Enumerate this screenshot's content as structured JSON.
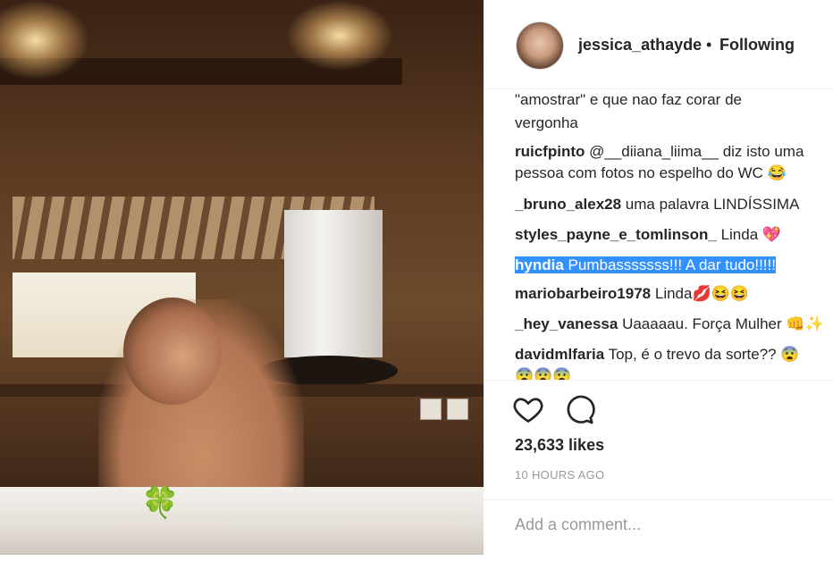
{
  "post": {
    "username": "jessica_athayde",
    "separator": "•",
    "follow_status": "Following",
    "photo_sticker": "🍀"
  },
  "comments": [
    {
      "user": "",
      "text": "\"amostrar\" e que nao faz corar de"
    },
    {
      "user": "",
      "text": "vergonha"
    },
    {
      "user": "ruicfpinto",
      "text": "@__diiana_liima__ diz isto uma"
    },
    {
      "user": "",
      "text": "pessoa com fotos no espelho do WC 😂"
    },
    {
      "user": "_bruno_alex28",
      "text": "uma palavra LINDÍSSIMA"
    },
    {
      "user": "styles_payne_e_tomlinson_",
      "text": "Linda 💖"
    },
    {
      "user": "hyndia",
      "text": "Pumbasssssss!!! A dar tudo!!!!!"
    },
    {
      "user": "mariobarbeiro1978",
      "text": "Linda💋😆😆"
    },
    {
      "user": "_hey_vanessa",
      "text": "Uaaaaau. Força Mulher 👊✨"
    },
    {
      "user": "davidmlfaria",
      "text": "Top, é o trevo da sorte?? 😨"
    },
    {
      "user": "",
      "text": "😨😨😨"
    }
  ],
  "actions": {
    "likes": "23,633 likes",
    "timestamp": "10 HOURS AGO",
    "comment_placeholder": "Add a comment..."
  },
  "colors": {
    "text": "#262626",
    "muted": "#999999",
    "selection": "#3390ff"
  },
  "icons": [
    "heart-icon",
    "comment-icon"
  ]
}
